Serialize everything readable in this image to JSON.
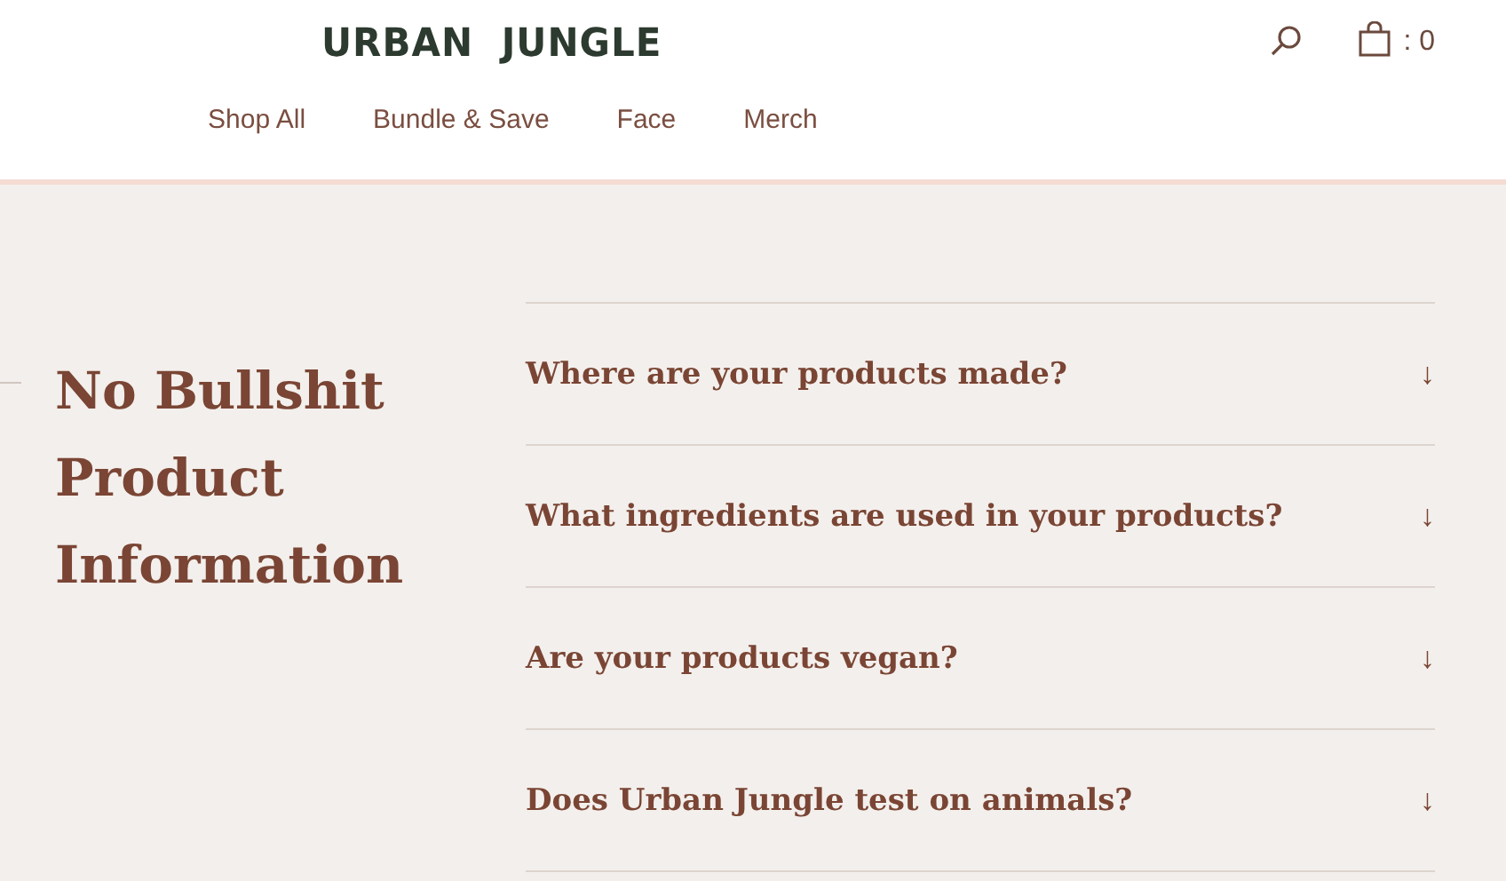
{
  "header": {
    "logo": "URBAN JUNGLE",
    "cart_count": ": 0",
    "nav": [
      {
        "label": "Shop All"
      },
      {
        "label": "Bundle & Save"
      },
      {
        "label": "Face"
      },
      {
        "label": "Merch"
      }
    ]
  },
  "faq": {
    "title": "No Bullshit Product Information",
    "items": [
      {
        "question": "Where are your products made?",
        "icon": "↓"
      },
      {
        "question": "What ingredients are used in your products?",
        "icon": "↓"
      },
      {
        "question": "Are your products vegan?",
        "icon": "↓"
      },
      {
        "question": "Does Urban Jungle test on animals?",
        "icon": "↓"
      }
    ]
  }
}
